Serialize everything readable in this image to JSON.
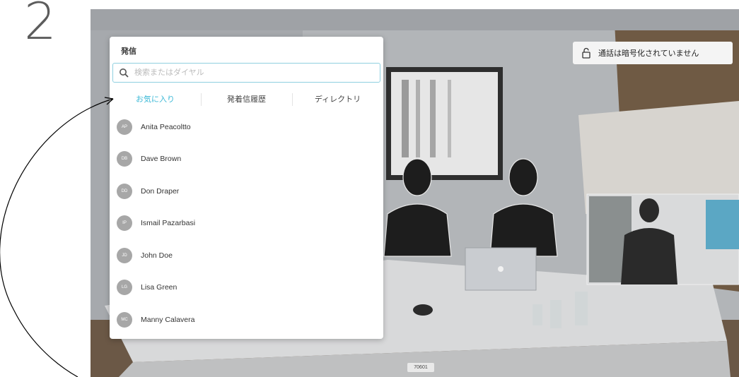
{
  "step_number": "2",
  "panel": {
    "title": "発信",
    "search_placeholder": "検索またはダイヤル",
    "tabs": [
      {
        "label": "お気に入り",
        "active": true
      },
      {
        "label": "発着信履歴",
        "active": false
      },
      {
        "label": "ディレクトリ",
        "active": false
      }
    ],
    "contacts": [
      {
        "name": "Anita Peacoltto",
        "initials": "AP"
      },
      {
        "name": "Dave Brown",
        "initials": "DB"
      },
      {
        "name": "Don Draper",
        "initials": "DD"
      },
      {
        "name": "Ismail Pazarbasi",
        "initials": "IP"
      },
      {
        "name": "John Doe",
        "initials": "JD"
      },
      {
        "name": "Lisa Green",
        "initials": "LG"
      },
      {
        "name": "Manny Calavera",
        "initials": "MC"
      }
    ]
  },
  "status": {
    "encryption_text": "通話は暗号化されていません",
    "icon": "lock-icon"
  },
  "call_id": "70601",
  "colors": {
    "accent": "#3ab8d6",
    "avatar": "#a7a7a7"
  }
}
